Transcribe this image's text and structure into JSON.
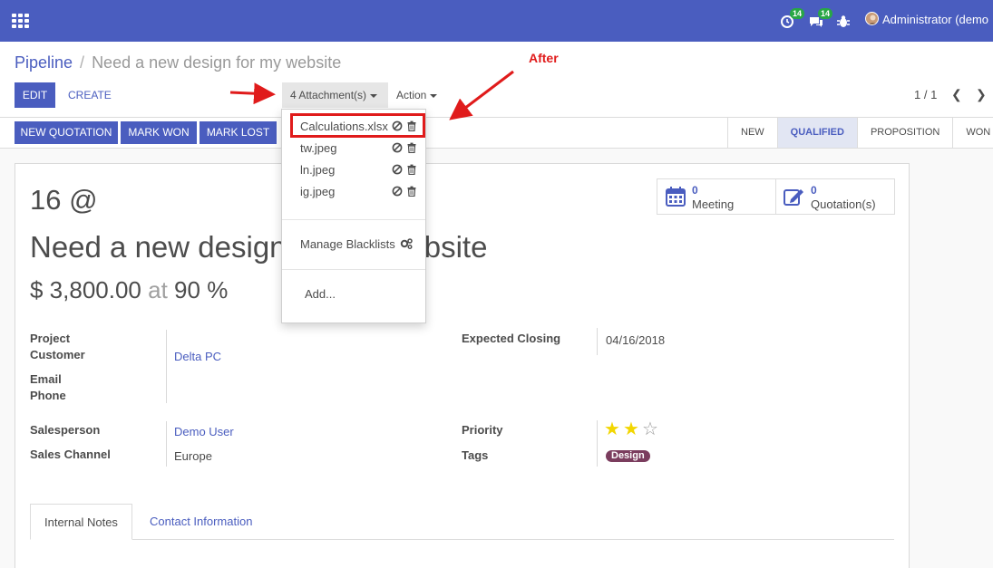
{
  "navbar": {
    "timer_badge": "14",
    "chat_badge": "14",
    "user_name": "Administrator (demo"
  },
  "breadcrumb": {
    "parent": "Pipeline",
    "separator": "/",
    "current": "Need a new design for my website"
  },
  "toolbar": {
    "edit_label": "EDIT",
    "create_label": "CREATE",
    "attachments_label": "4 Attachment(s)",
    "action_label": "Action",
    "pager": "1 / 1"
  },
  "actions": {
    "new_quotation": "NEW QUOTATION",
    "mark_won": "MARK WON",
    "mark_lost": "MARK LOST"
  },
  "stages": [
    {
      "label": "NEW",
      "active": false
    },
    {
      "label": "QUALIFIED",
      "active": true
    },
    {
      "label": "PROPOSITION",
      "active": false
    },
    {
      "label": "WON",
      "active": false
    }
  ],
  "smart_buttons": {
    "meeting_count": "0",
    "meeting_label": "Meeting",
    "quotation_count": "0",
    "quotation_label": "Quotation(s)"
  },
  "record": {
    "reference": "16 @",
    "title": "Need a new design for my website",
    "revenue": "$ 3,800.00",
    "at": "at",
    "probability": "90 %"
  },
  "fields": {
    "project_label": "Project",
    "customer_label": "Customer",
    "customer_value": "Delta PC",
    "email_label": "Email",
    "phone_label": "Phone",
    "expected_closing_label": "Expected Closing",
    "expected_closing_value": "04/16/2018",
    "salesperson_label": "Salesperson",
    "salesperson_value": "Demo User",
    "sales_channel_label": "Sales Channel",
    "sales_channel_value": "Europe",
    "priority_label": "Priority",
    "priority_stars": 2,
    "priority_max": 3,
    "tags_label": "Tags",
    "tag_value": "Design"
  },
  "tabs": [
    {
      "label": "Internal Notes",
      "active": true
    },
    {
      "label": "Contact Information",
      "active": false
    }
  ],
  "dropdown": {
    "attachments": [
      {
        "name": "Calculations.xlsx",
        "highlighted": true
      },
      {
        "name": "tw.jpeg",
        "highlighted": false
      },
      {
        "name": "ln.jpeg",
        "highlighted": false
      },
      {
        "name": "ig.jpeg",
        "highlighted": false
      }
    ],
    "manage_blacklists": "Manage Blacklists",
    "add": "Add..."
  },
  "annotation": {
    "after_label": "After",
    "color": "#e01b1b"
  },
  "colors": {
    "brand": "#4a5dbf",
    "star": "#f2d600",
    "tag": "#7b3d5e"
  }
}
